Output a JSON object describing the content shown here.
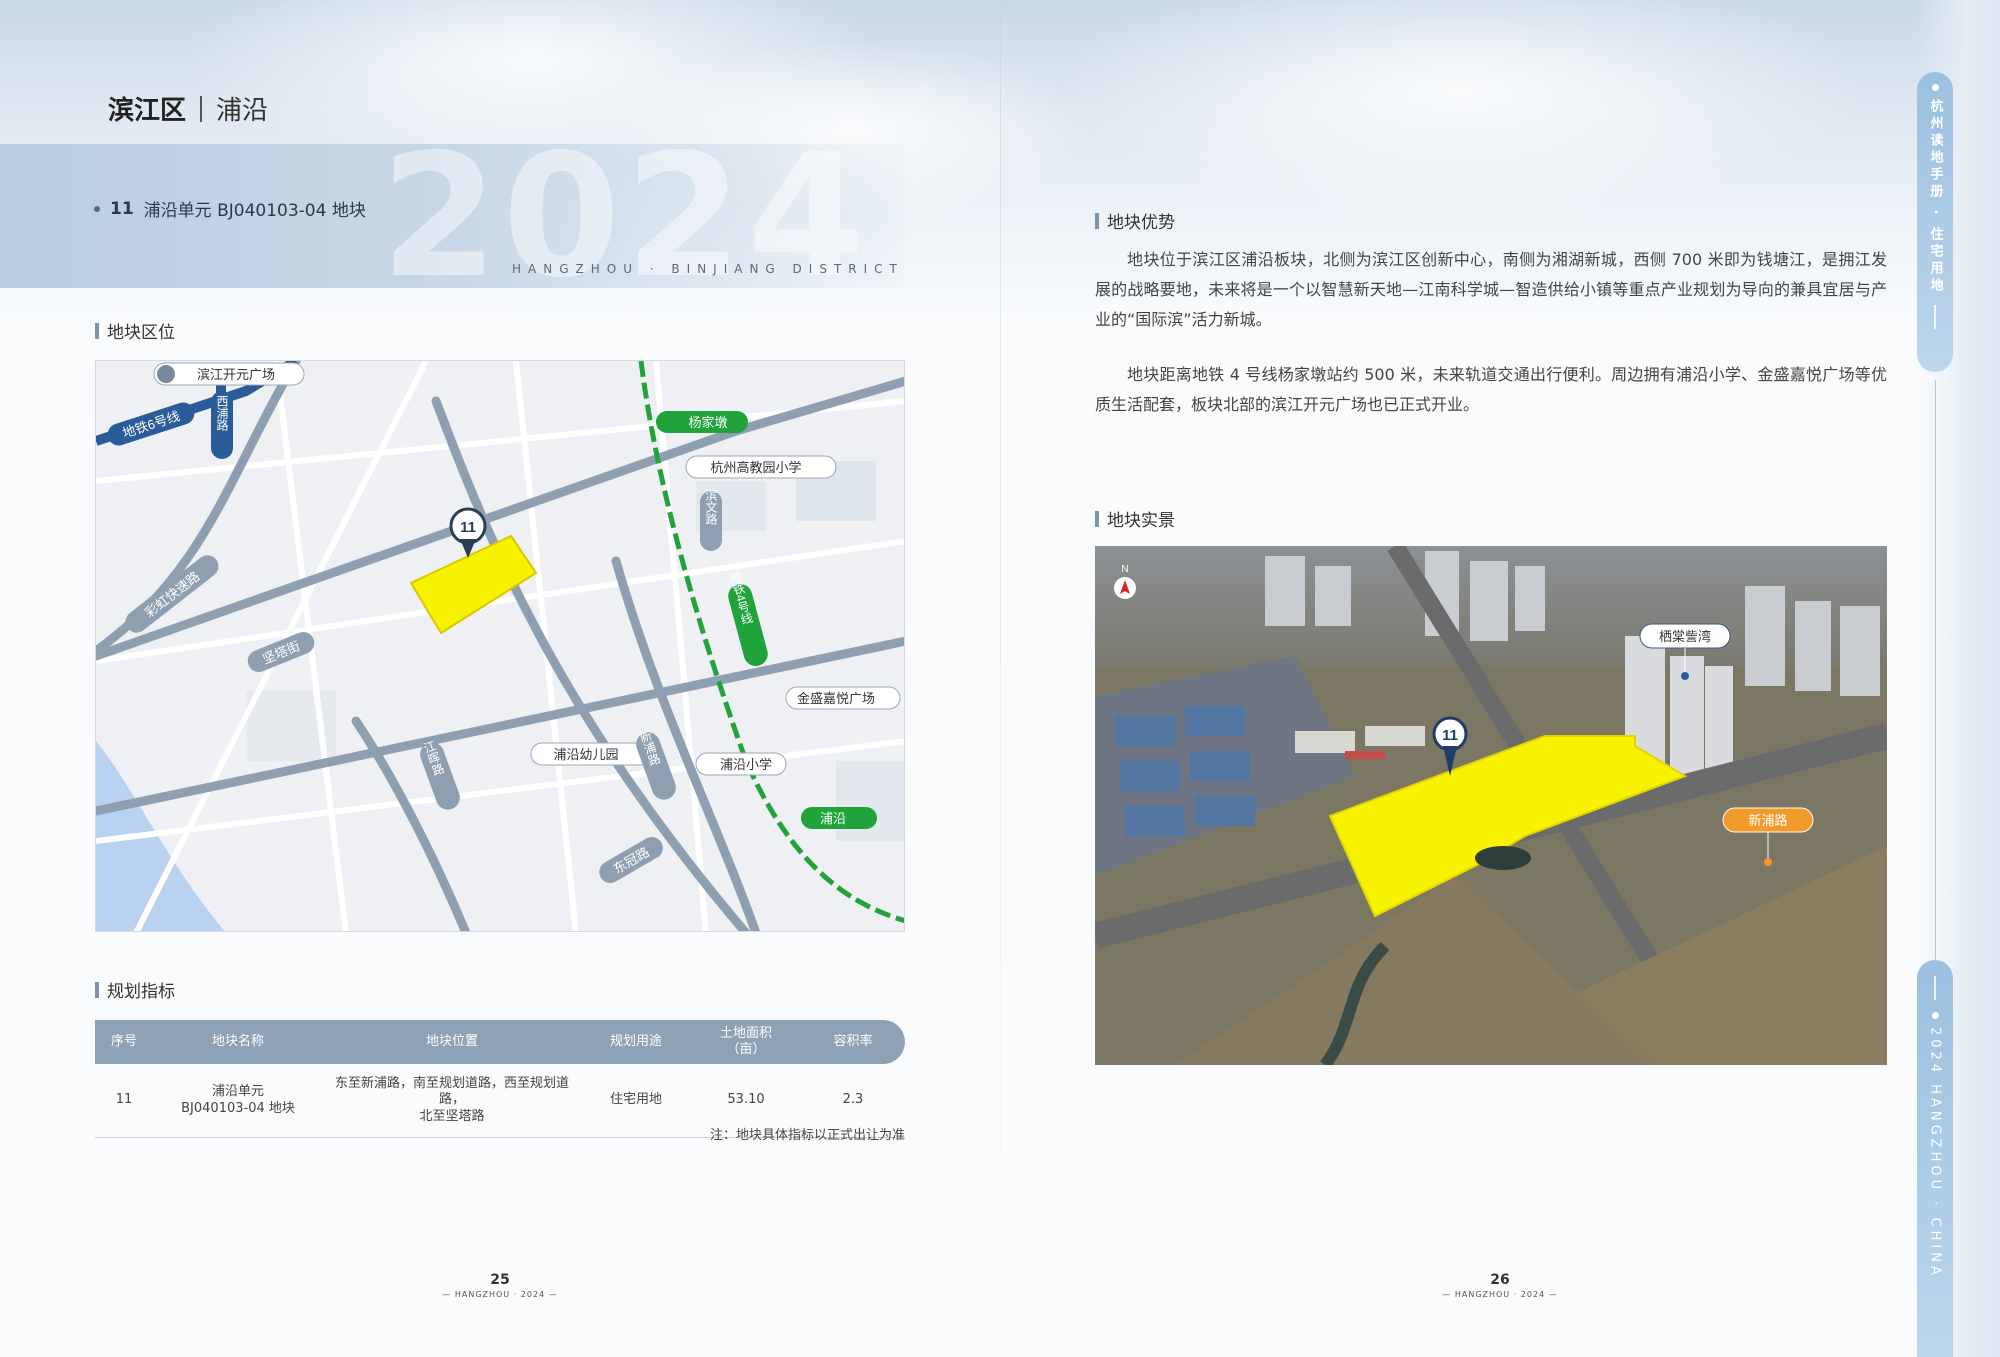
{
  "header": {
    "district": "滨江区",
    "area": "浦沿"
  },
  "banner": {
    "year": "2024",
    "district_en": "HANGZHOU · BINJIANG DISTRICT"
  },
  "plot": {
    "number": "11",
    "name": "浦沿单元 BJ040103-04 地块"
  },
  "sections": {
    "location": "地块区位",
    "indicators": "规划指标",
    "advantages": "地块优势",
    "photo": "地块实景"
  },
  "map_labels": {
    "marker": "11",
    "metro_line6": "地铁6号线",
    "metro_line4": "地铁4号线",
    "xipu_road": "西浦路",
    "yangjiadun": "杨家墩",
    "binjiang_kaiyuan": "滨江开元广场",
    "hangzhou_gaojiaoyuan": "杭州高教园小学",
    "jiangnan_road": "滨文路",
    "caihong_road": "彩虹快速路",
    "jianta_street": "坚塔街",
    "jinsheng_plaza": "金盛嘉悦广场",
    "puyan_kindergarten": "浦沿幼儿园",
    "puyan_primary": "浦沿小学",
    "xinpu_road": "新浦路",
    "puyan_station": "浦沿",
    "dongguan_road": "东冠路",
    "jiangyu_road": "江晖路"
  },
  "table": {
    "headers": [
      "序号",
      "地块名称",
      "地块位置",
      "规划用途",
      "土地面积（亩）",
      "容积率"
    ],
    "rows": [
      {
        "no": "11",
        "name_line1": "浦沿单元",
        "name_line2": "BJ040103-04 地块",
        "loc_line1": "东至新浦路，南至规划道路，西至规划道路，",
        "loc_line2": "北至坚塔路",
        "use": "住宅用地",
        "area": "53.10",
        "far": "2.3"
      }
    ],
    "note": "注：地块具体指标以正式出让为准"
  },
  "advantages": {
    "para1": "地块位于滨江区浦沿板块，北侧为滨江区创新中心，南侧为湘湖新城，西侧 700 米即为钱塘江，是拥江发展的战略要地，未来将是一个以智慧新天地—江南科学城—智造供给小镇等重点产业规划为导向的兼具宜居与产业的“国际滨”活力新城。",
    "para2": "地块距离地铁 4 号线杨家墩站约 500 米，未来轨道交通出行便利。周边拥有浦沿小学、金盛嘉悦广场等优质生活配套，板块北部的滨江开元广场也已正式开业。"
  },
  "photo_labels": {
    "compass": "N",
    "marker": "11",
    "community": "栖棠訾湾",
    "road": "新浦路"
  },
  "pages": {
    "left": "25",
    "right": "26",
    "sub": "— HANGZHOU · 2024 —"
  },
  "rail": {
    "top_text": "杭州读地手册 · 住宅用地",
    "bottom_text": "2024 HANGZHOU · CHINA"
  },
  "colors": {
    "accent": "#8ea2b6",
    "plot_fill": "#f7f200",
    "metro_green": "#1fa33a",
    "metro_blue": "#2a5c9a"
  }
}
